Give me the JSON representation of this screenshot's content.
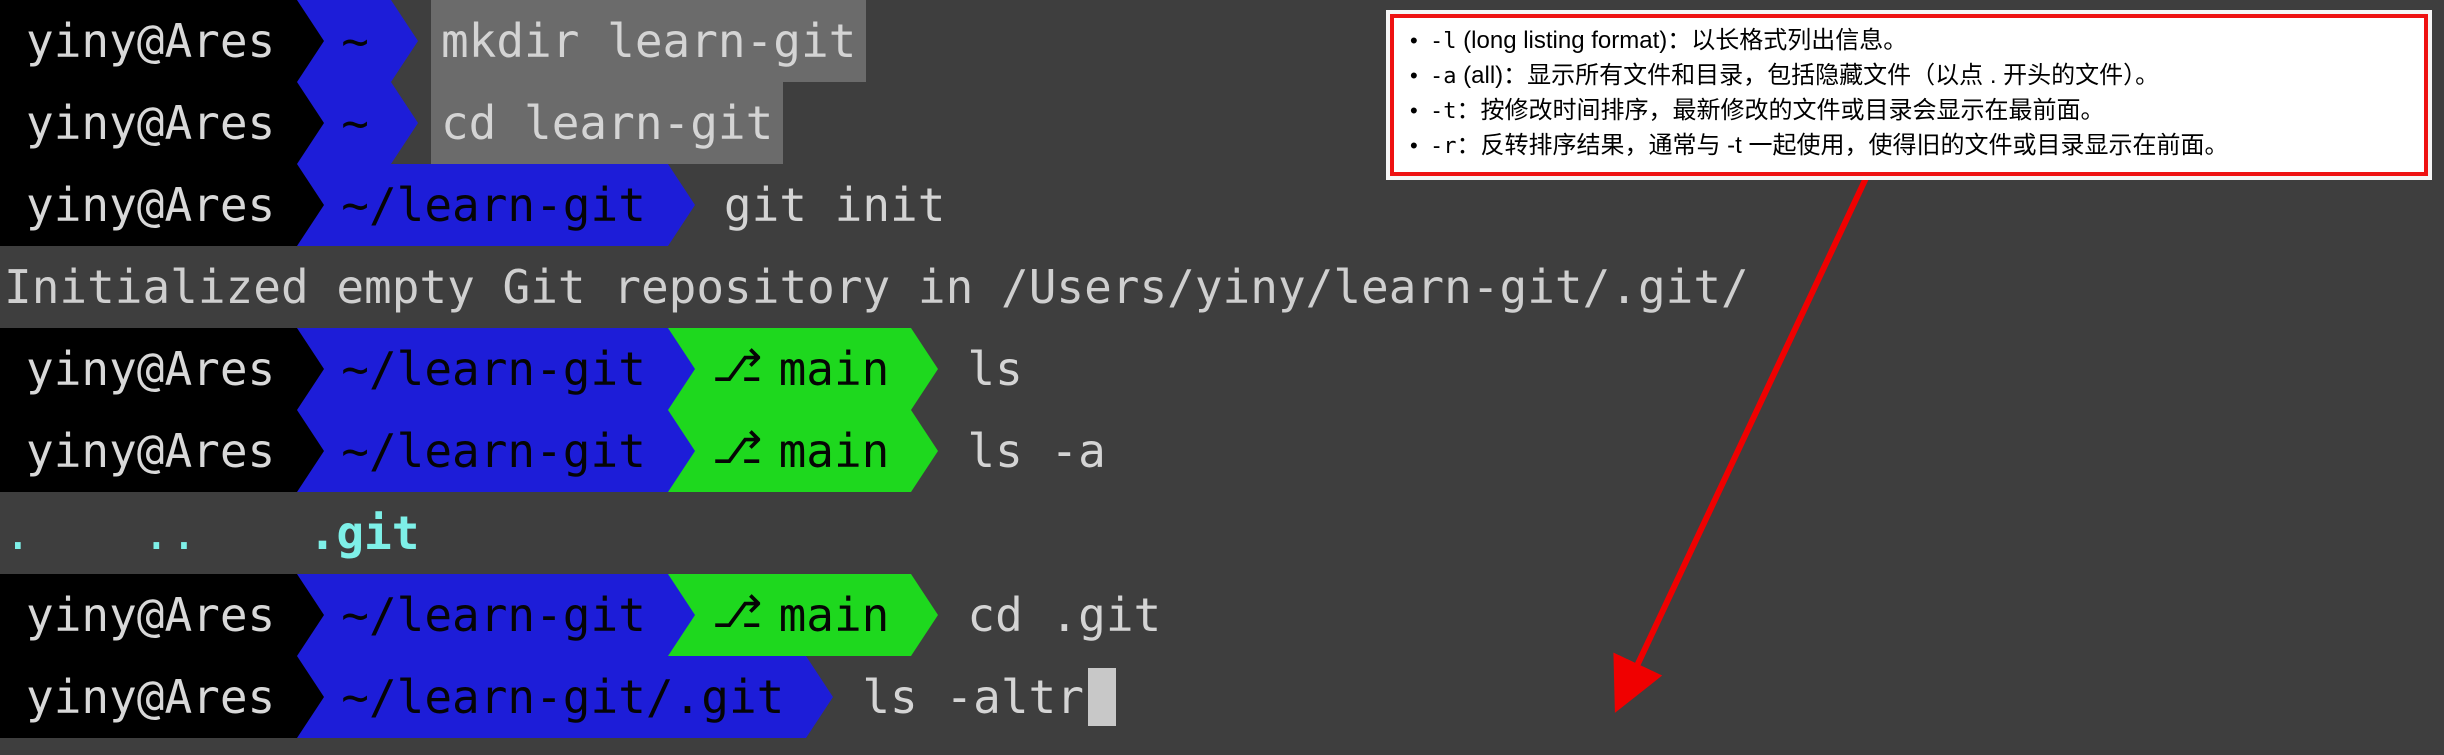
{
  "theme": {
    "terminal_bg": "#3e3e3e",
    "terminal_fg": "#d4d4d4",
    "segment_user_bg": "#000000",
    "segment_path_bg": "#1d1dd8",
    "segment_branch_bg": "#1ed81e",
    "highlight_bg": "#6b6b6b",
    "output_cyan": "#7ef0e8",
    "callout_border": "#ee1111",
    "callout_bg": "#ffffff",
    "arrow_color": "#f00000",
    "cursor_color": "#c8c8c8"
  },
  "prompt": {
    "user_host": "yiny@Ares",
    "branch_icon": "⎇",
    "branch_name": "main"
  },
  "lines": [
    {
      "type": "prompt",
      "user_host": "yiny@Ares",
      "path": "~",
      "branch": null,
      "command": "mkdir learn-git",
      "highlight": true
    },
    {
      "type": "prompt",
      "user_host": "yiny@Ares",
      "path": "~",
      "branch": null,
      "command": "cd learn-git",
      "highlight": true
    },
    {
      "type": "prompt",
      "user_host": "yiny@Ares",
      "path": "~/learn-git",
      "branch": null,
      "command": "git init",
      "highlight": false
    },
    {
      "type": "output",
      "text": "Initialized empty Git repository in /Users/yiny/learn-git/.git/"
    },
    {
      "type": "prompt",
      "user_host": "yiny@Ares",
      "path": "~/learn-git",
      "branch": "main",
      "command": "ls",
      "highlight": false
    },
    {
      "type": "prompt",
      "user_host": "yiny@Ares",
      "path": "~/learn-git",
      "branch": "main",
      "command": "ls -a",
      "highlight": false
    },
    {
      "type": "listing",
      "entries": [
        ".",
        "..",
        ".git"
      ]
    },
    {
      "type": "prompt",
      "user_host": "yiny@Ares",
      "path": "~/learn-git",
      "branch": "main",
      "command": "cd .git",
      "highlight": false
    },
    {
      "type": "prompt",
      "user_host": "yiny@Ares",
      "path": "~/learn-git/.git",
      "branch": null,
      "command": "ls -altr",
      "highlight": false,
      "cursor": true
    }
  ],
  "callout": {
    "bullets": [
      {
        "flag": "-l",
        "text": " (long listing format)：以长格式列出信息。"
      },
      {
        "flag": "-a",
        "text": " (all)：显示所有文件和目录，包括隐藏文件（以点 . 开头的文件）。"
      },
      {
        "flag": "-t",
        "text": "：按修改时间排序，最新修改的文件或目录会显示在最前面。"
      },
      {
        "flag": "-r",
        "text": "：反转排序结果，通常与 -t 一起使用，使得旧的文件或目录显示在前面。"
      }
    ]
  },
  "listing_entries": {
    "dot": ".",
    "dotdot": "..",
    "git": ".git"
  }
}
